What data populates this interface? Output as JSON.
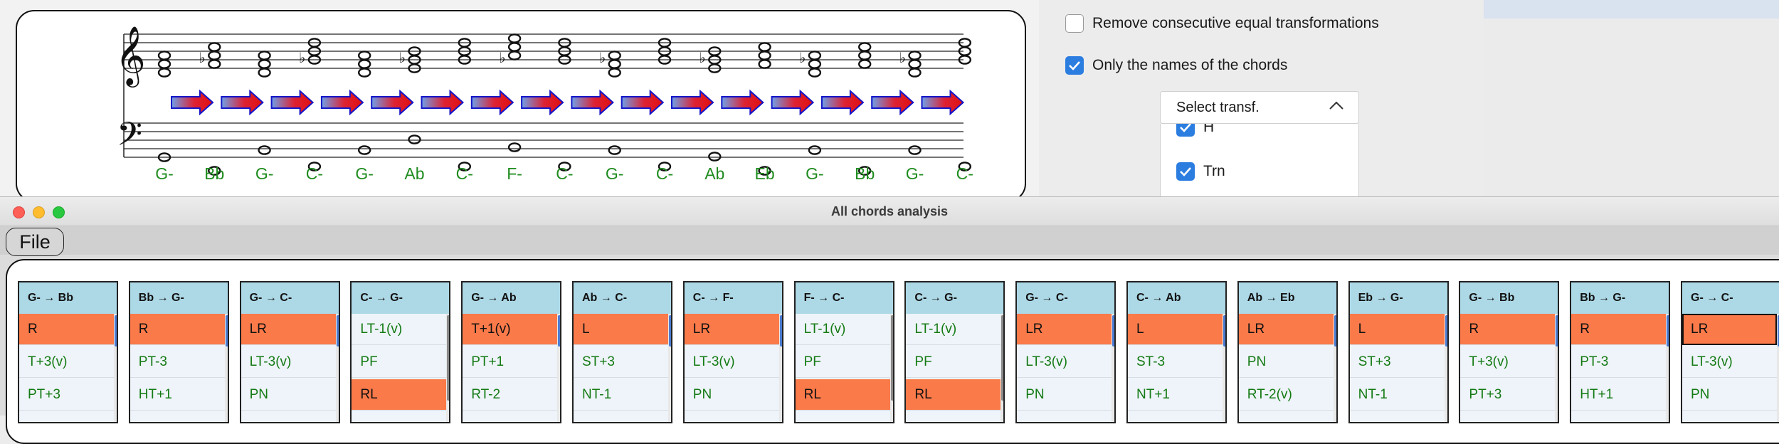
{
  "score": {
    "chord_names": [
      "G-",
      "Bb",
      "G-",
      "C-",
      "G-",
      "Ab",
      "C-",
      "F-",
      "C-",
      "G-",
      "C-",
      "Ab",
      "Eb",
      "G-",
      "Bb",
      "G-",
      "C-"
    ],
    "accent_color": "#1f8c1f"
  },
  "options": {
    "remove_consecutive_label": "Remove consecutive equal transformations",
    "remove_consecutive_checked": false,
    "only_names_label": "Only the names of the chords",
    "only_names_checked": true
  },
  "transf_dropdown": {
    "label": "Select transf.",
    "items": [
      {
        "label": "H",
        "checked": true
      },
      {
        "label": "Trn",
        "checked": true
      },
      {
        "label": "",
        "checked": true
      }
    ]
  },
  "window": {
    "title": "All chords analysis",
    "menu_file": "File"
  },
  "colors": {
    "header_bg": "#add8e6",
    "highlight": "#fa7a4a",
    "transform_text": "#147a14",
    "checkbox_blue": "#2b7de0"
  },
  "cards": [
    {
      "header": "G- → Bb",
      "rows": [
        {
          "t": "R",
          "hl": true
        },
        {
          "t": "T+3(v)",
          "hl": false
        },
        {
          "t": "PT+3",
          "hl": false
        }
      ]
    },
    {
      "header": "Bb → G-",
      "rows": [
        {
          "t": "R",
          "hl": true
        },
        {
          "t": "PT-3",
          "hl": false
        },
        {
          "t": "HT+1",
          "hl": false
        }
      ]
    },
    {
      "header": "G- → C-",
      "rows": [
        {
          "t": "LR",
          "hl": true
        },
        {
          "t": "LT-3(v)",
          "hl": false
        },
        {
          "t": "PN",
          "hl": false
        }
      ]
    },
    {
      "header": "C- → G-",
      "rows": [
        {
          "t": "LT-1(v)",
          "hl": false
        },
        {
          "t": "PF",
          "hl": false
        },
        {
          "t": "RL",
          "hl": true
        }
      ]
    },
    {
      "header": "G- → Ab",
      "rows": [
        {
          "t": "T+1(v)",
          "hl": true
        },
        {
          "t": "PT+1",
          "hl": false
        },
        {
          "t": "RT-2",
          "hl": false
        }
      ]
    },
    {
      "header": "Ab → C-",
      "rows": [
        {
          "t": "L",
          "hl": true
        },
        {
          "t": "ST+3",
          "hl": false
        },
        {
          "t": "NT-1",
          "hl": false
        }
      ]
    },
    {
      "header": "C- → F-",
      "rows": [
        {
          "t": "LR",
          "hl": true
        },
        {
          "t": "LT-3(v)",
          "hl": false
        },
        {
          "t": "PN",
          "hl": false
        }
      ]
    },
    {
      "header": "F- → C-",
      "rows": [
        {
          "t": "LT-1(v)",
          "hl": false
        },
        {
          "t": "PF",
          "hl": false
        },
        {
          "t": "RL",
          "hl": true
        }
      ]
    },
    {
      "header": "C- → G-",
      "rows": [
        {
          "t": "LT-1(v)",
          "hl": false
        },
        {
          "t": "PF",
          "hl": false
        },
        {
          "t": "RL",
          "hl": true
        }
      ]
    },
    {
      "header": "G- → C-",
      "rows": [
        {
          "t": "LR",
          "hl": true
        },
        {
          "t": "LT-3(v)",
          "hl": false
        },
        {
          "t": "PN",
          "hl": false
        }
      ]
    },
    {
      "header": "C- → Ab",
      "rows": [
        {
          "t": "L",
          "hl": true
        },
        {
          "t": "ST-3",
          "hl": false
        },
        {
          "t": "NT+1",
          "hl": false
        }
      ]
    },
    {
      "header": "Ab → Eb",
      "rows": [
        {
          "t": "LR",
          "hl": true
        },
        {
          "t": "PN",
          "hl": false
        },
        {
          "t": "RT-2(v)",
          "hl": false
        }
      ]
    },
    {
      "header": "Eb → G-",
      "rows": [
        {
          "t": "L",
          "hl": true
        },
        {
          "t": "ST+3",
          "hl": false
        },
        {
          "t": "NT-1",
          "hl": false
        }
      ]
    },
    {
      "header": "G- → Bb",
      "rows": [
        {
          "t": "R",
          "hl": true
        },
        {
          "t": "T+3(v)",
          "hl": false
        },
        {
          "t": "PT+3",
          "hl": false
        }
      ]
    },
    {
      "header": "Bb → G-",
      "rows": [
        {
          "t": "R",
          "hl": true
        },
        {
          "t": "PT-3",
          "hl": false
        },
        {
          "t": "HT+1",
          "hl": false
        }
      ]
    },
    {
      "header": "G- → C-",
      "rows": [
        {
          "t": "LR",
          "hl": true,
          "sel": true
        },
        {
          "t": "LT-3(v)",
          "hl": false
        },
        {
          "t": "PN",
          "hl": false
        }
      ]
    }
  ]
}
